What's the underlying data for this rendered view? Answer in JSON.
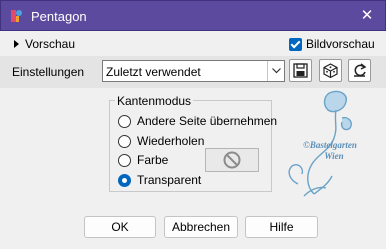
{
  "window": {
    "title": "Pentagon",
    "close_glyph": "✕"
  },
  "preview": {
    "label": "Vorschau",
    "image_preview_label": "Bildvorschau",
    "image_preview_checked": true
  },
  "settings": {
    "label": "Einstellungen",
    "selected": "Zuletzt verwendet",
    "tools": [
      "save-icon",
      "random-dice-icon",
      "reset-icon"
    ]
  },
  "edge_mode": {
    "group_label": "Kantenmodus",
    "options": [
      "Andere Seite übernehmen",
      "Wiederholen",
      "Farbe",
      "Transparent"
    ],
    "selected_index": 3
  },
  "watermark": {
    "line1": "©Bastelgarten",
    "line2": "Wien"
  },
  "buttons": {
    "ok": "OK",
    "cancel": "Abbrechen",
    "help": "Hilfe"
  },
  "colors": {
    "titlebar": "#5b4a9e",
    "accent": "#0067c0",
    "watermark": "#6aa3c8"
  }
}
